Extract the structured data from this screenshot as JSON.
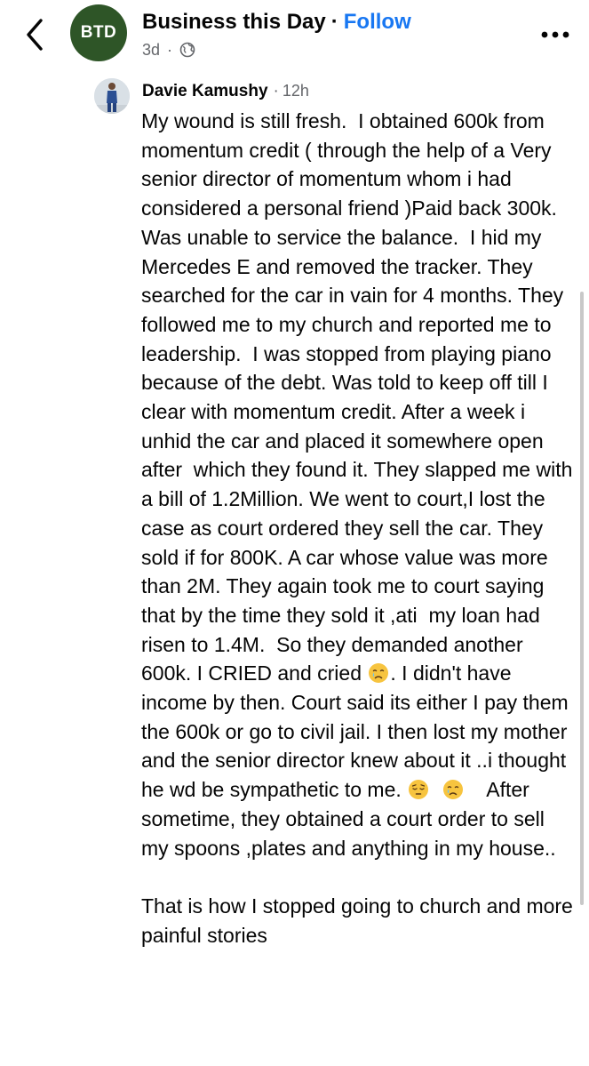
{
  "header": {
    "page_name": "Business this Day",
    "separator": "·",
    "follow_label": "Follow",
    "avatar_initials": "BTD",
    "avatar_color": "#2e5527",
    "post_age": "3d",
    "audience_icon": "globe-icon"
  },
  "comment": {
    "author": "Davie Kamushy",
    "separator": "·",
    "time": "12h",
    "body": [
      "My wound is still fresh.  I obtained 600k from momentum credit ( through the help of a Very senior director of momentum whom i had considered a personal friend )Paid back 300k. Was unable to service the balance.  I hid my Mercedes E and removed the tracker. They searched for the car in vain for 4 months. They followed me to my church and reported me to leadership.  I was stopped from playing piano because of the debt. Was told to keep off till I clear with momentum credit. After a week i unhid the car and placed it somewhere open after  which they found it. They slapped me with a bill of 1.2Million. We went to court,I lost the case as court ordered they sell the car. They sold if for 800K. A car whose value was more than 2M. They again took me to court saying that by the time they sold it ,ati  my loan had risen to 1.4M.  So they demanded another 600k. I CRIED and cried",
      ". I didn't have income by then. Court said its either I pay them the 600k or go to civil jail. I then lost my mother and the senior director knew about it ..i thought he wd be sympathetic to me.",
      "After sometime, they obtained a court order to sell my spoons ,plates and anything in my house..\n\nThat is how I stopped going to church and more painful stories"
    ]
  },
  "colors": {
    "accent": "#1877f2",
    "secondary_text": "#65676b"
  }
}
